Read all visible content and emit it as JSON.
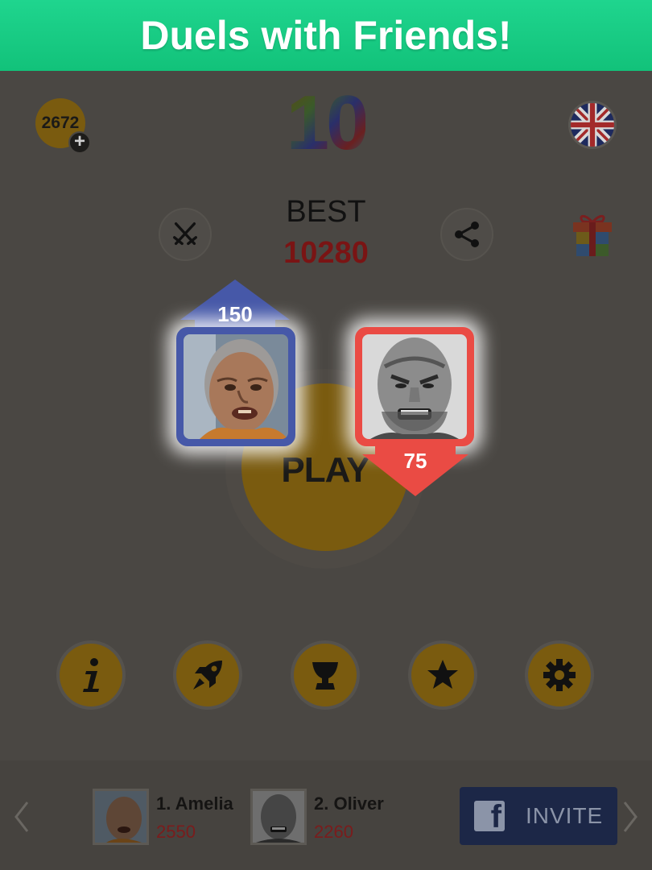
{
  "banner": {
    "title": "Duels with Friends!"
  },
  "header": {
    "coins": "2672",
    "logo_number": "10",
    "language_icon": "uk-flag-icon"
  },
  "best": {
    "label": "BEST",
    "value": "10280"
  },
  "actions": {
    "duel_icon": "crossed-swords-icon",
    "share_icon": "share-icon",
    "gift_icon": "gift-icon"
  },
  "play": {
    "label": "PLAY"
  },
  "duel": {
    "player_up_score": "150",
    "player_down_score": "75"
  },
  "menu": {
    "items": [
      {
        "icon": "info-icon"
      },
      {
        "icon": "rocket-icon"
      },
      {
        "icon": "trophy-icon"
      },
      {
        "icon": "star-icon"
      },
      {
        "icon": "gear-icon"
      }
    ]
  },
  "leaderboard": {
    "entries": [
      {
        "name": "1. Amelia",
        "score": "2550"
      },
      {
        "name": "2. Oliver",
        "score": "2260"
      }
    ],
    "invite_label": "INVITE"
  },
  "colors": {
    "banner": "#12c27a",
    "blue_card": "#4658a8",
    "red_card": "#ea4b44",
    "dimmed_gold": "#7a5b0f",
    "best_red": "#7a1414"
  }
}
